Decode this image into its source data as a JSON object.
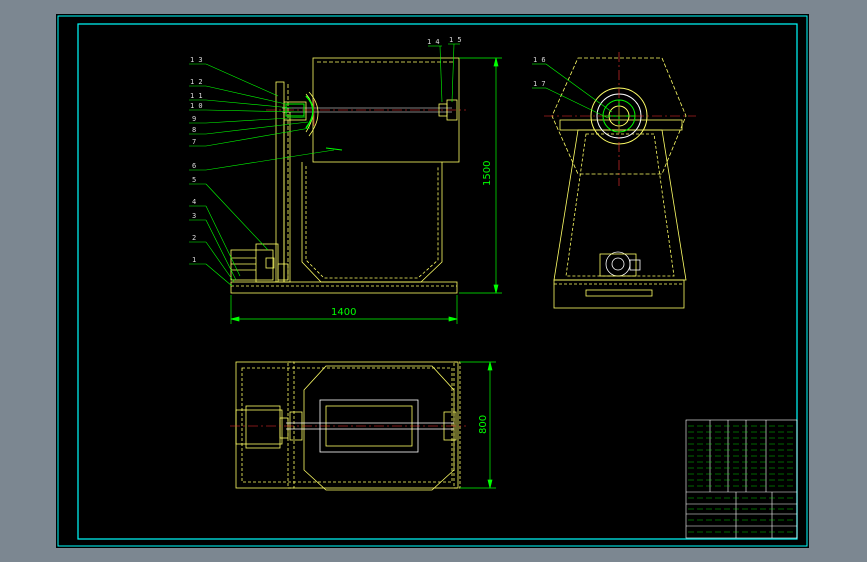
{
  "drawing": {
    "dimensions": {
      "overall_length": "1400",
      "overall_height": "1500",
      "plan_width": "800"
    },
    "callouts_front": [
      "1 3",
      "1 2",
      "1 1",
      "1 0",
      "9",
      "8",
      "7",
      "6",
      "5",
      "4",
      "3",
      "2",
      "1"
    ],
    "callouts_top": [
      "1 4",
      "1 5"
    ],
    "callouts_side": [
      "1 6",
      "1 7"
    ],
    "colors": {
      "background": "#000000",
      "frame": "#00ffff",
      "outline": "#ffff66",
      "dimension": "#00ff00",
      "centerline": "#ff3333",
      "page": "#7c8791"
    }
  }
}
